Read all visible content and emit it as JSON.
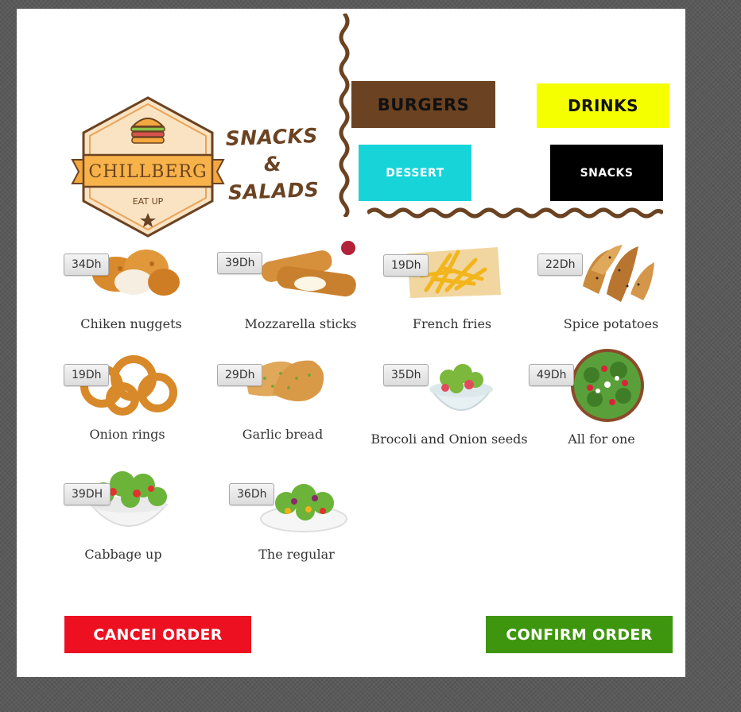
{
  "brand": {
    "name": "CHILLBERG",
    "tagline": "EAT UP",
    "section_title_line1": "SNACKS &",
    "section_title_line2": "SALADS"
  },
  "categories": [
    {
      "label": "BURGERS",
      "color": "#6b4322"
    },
    {
      "label": "DRINKS",
      "color": "#f5ff00"
    },
    {
      "label": "DESSERT",
      "color": "#17d4d9"
    },
    {
      "label": "SNACKS",
      "color": "#000000"
    }
  ],
  "items": [
    {
      "name": "Chiken nuggets",
      "price": "34Dh",
      "image": "nuggets-image"
    },
    {
      "name": "Mozzarella sticks",
      "price": "39Dh",
      "image": "mozzarella-image"
    },
    {
      "name": "French fries",
      "price": "19Dh",
      "image": "fries-image"
    },
    {
      "name": "Spice potatoes",
      "price": "22Dh",
      "image": "potatoes-image"
    },
    {
      "name": "Onion rings",
      "price": "19Dh",
      "image": "onion-rings-image"
    },
    {
      "name": "Garlic bread",
      "price": "29Dh",
      "image": "garlic-bread-image"
    },
    {
      "name": "Brocoli and Onion seeds",
      "price": "35Dh",
      "image": "brocoli-salad-image"
    },
    {
      "name": "All for one",
      "price": "49Dh",
      "image": "all-for-one-salad-image"
    },
    {
      "name": "Cabbage up",
      "price": "39DH",
      "image": "cabbage-salad-image"
    },
    {
      "name": "The regular",
      "price": "36Dh",
      "image": "regular-salad-image"
    }
  ],
  "actions": {
    "cancel_label": "CANCEl ORDER",
    "confirm_label": "CONFIRM ORDER",
    "cancel_color": "#ec1021",
    "confirm_color": "#3e960e"
  }
}
